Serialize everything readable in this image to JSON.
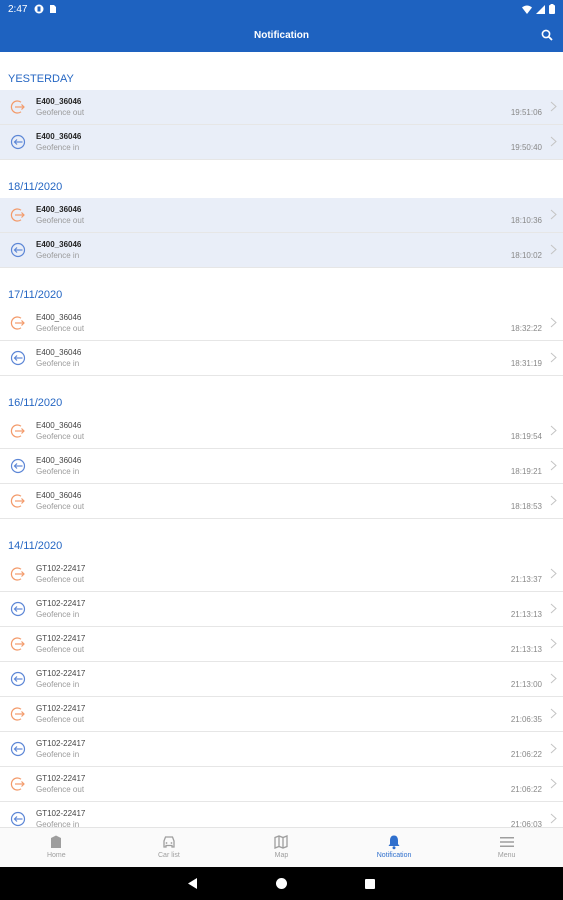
{
  "status_bar": {
    "time": "2:47"
  },
  "app_bar": {
    "title": "Notification"
  },
  "sections": [
    {
      "date": "YESTERDAY",
      "items": [
        {
          "device": "E400_36046",
          "event": "Geofence out",
          "time": "19:51:06",
          "type": "out",
          "unread": true
        },
        {
          "device": "E400_36046",
          "event": "Geofence in",
          "time": "19:50:40",
          "type": "in",
          "unread": true
        }
      ]
    },
    {
      "date": "18/11/2020",
      "items": [
        {
          "device": "E400_36046",
          "event": "Geofence out",
          "time": "18:10:36",
          "type": "out",
          "unread": true
        },
        {
          "device": "E400_36046",
          "event": "Geofence in",
          "time": "18:10:02",
          "type": "in",
          "unread": true
        }
      ]
    },
    {
      "date": "17/11/2020",
      "items": [
        {
          "device": "E400_36046",
          "event": "Geofence out",
          "time": "18:32:22",
          "type": "out",
          "unread": false
        },
        {
          "device": "E400_36046",
          "event": "Geofence in",
          "time": "18:31:19",
          "type": "in",
          "unread": false
        }
      ]
    },
    {
      "date": "16/11/2020",
      "items": [
        {
          "device": "E400_36046",
          "event": "Geofence out",
          "time": "18:19:54",
          "type": "out",
          "unread": false
        },
        {
          "device": "E400_36046",
          "event": "Geofence in",
          "time": "18:19:21",
          "type": "in",
          "unread": false
        },
        {
          "device": "E400_36046",
          "event": "Geofence out",
          "time": "18:18:53",
          "type": "out",
          "unread": false
        }
      ]
    },
    {
      "date": "14/11/2020",
      "items": [
        {
          "device": "GT102-22417",
          "event": "Geofence out",
          "time": "21:13:37",
          "type": "out",
          "unread": false
        },
        {
          "device": "GT102-22417",
          "event": "Geofence in",
          "time": "21:13:13",
          "type": "in",
          "unread": false
        },
        {
          "device": "GT102-22417",
          "event": "Geofence out",
          "time": "21:13:13",
          "type": "out",
          "unread": false
        },
        {
          "device": "GT102-22417",
          "event": "Geofence in",
          "time": "21:13:00",
          "type": "in",
          "unread": false
        },
        {
          "device": "GT102-22417",
          "event": "Geofence out",
          "time": "21:06:35",
          "type": "out",
          "unread": false
        },
        {
          "device": "GT102-22417",
          "event": "Geofence in",
          "time": "21:06:22",
          "type": "in",
          "unread": false
        },
        {
          "device": "GT102-22417",
          "event": "Geofence out",
          "time": "21:06:22",
          "type": "out",
          "unread": false
        },
        {
          "device": "GT102-22417",
          "event": "Geofence in",
          "time": "21:06:03",
          "type": "in",
          "unread": false
        }
      ]
    }
  ],
  "bottom_nav": [
    {
      "label": "Home",
      "icon": "home-icon",
      "active": false
    },
    {
      "label": "Car list",
      "icon": "car-icon",
      "active": false
    },
    {
      "label": "Map",
      "icon": "map-icon",
      "active": false
    },
    {
      "label": "Notification",
      "icon": "bell-icon",
      "active": true
    },
    {
      "label": "Menu",
      "icon": "menu-icon",
      "active": false
    }
  ],
  "colors": {
    "primary": "#1e62c0",
    "section_header": "#2667c3",
    "geofence_out": "#f39a6a",
    "geofence_in": "#5c86d6",
    "unread_bg": "#e9eef8",
    "nav_active": "#2f6fcd"
  }
}
